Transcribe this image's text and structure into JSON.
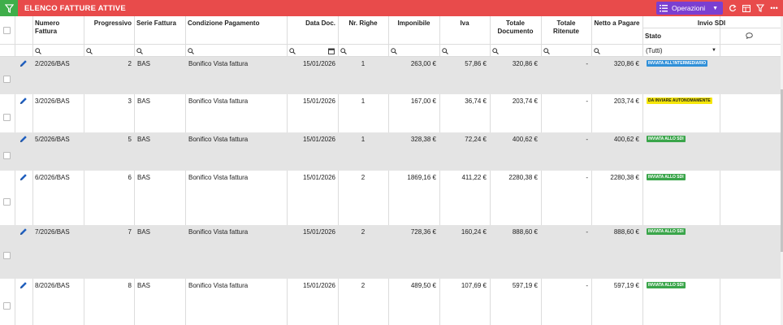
{
  "header": {
    "title": "ELENCO FATTURE ATTIVE",
    "operations_label": "Operazioni",
    "filter_icon": "filter-funnel-icon"
  },
  "colors": {
    "topbar": "#e84b4b",
    "filter_button": "#3fae4a",
    "operations_button": "#7a3fd1",
    "badge_blue": "#2f8fd8",
    "badge_yellow": "#f5e60a",
    "badge_green": "#3aa54a"
  },
  "columns": {
    "numero": "Numero Fattura",
    "progressivo": "Progressivo",
    "serie": "Serie Fattura",
    "condizione": "Condizione Pagamento",
    "data": "Data Doc.",
    "righe": "Nr. Righe",
    "imponibile": "Imponibile",
    "iva": "Iva",
    "totale_1": "Totale",
    "totale_2": "Documento",
    "ritenute": "Totale Ritenute",
    "netto": "Netto a Pagare",
    "sdi": "Invio SDI",
    "stato": "Stato"
  },
  "filters": {
    "stato_selected": "(Tutti)"
  },
  "rows": [
    {
      "numero": "2/2026/BAS",
      "progressivo": "2",
      "serie": "BAS",
      "condizione": "Bonifico Vista fattura",
      "data": "15/01/2026",
      "righe": "1",
      "imponibile": "263,00 €",
      "iva": "57,86 €",
      "totale": "320,86 €",
      "ritenute": "-",
      "netto": "320,86 €",
      "stato": "INVIATA ALL'INTERMEDIARIO"
    },
    {
      "numero": "3/2026/BAS",
      "progressivo": "3",
      "serie": "BAS",
      "condizione": "Bonifico Vista fattura",
      "data": "15/01/2026",
      "righe": "1",
      "imponibile": "167,00 €",
      "iva": "36,74 €",
      "totale": "203,74 €",
      "ritenute": "-",
      "netto": "203,74 €",
      "stato": "DA INVIARE AUTONOMAMENTE"
    },
    {
      "numero": "5/2026/BAS",
      "progressivo": "5",
      "serie": "BAS",
      "condizione": "Bonifico Vista fattura",
      "data": "15/01/2026",
      "righe": "1",
      "imponibile": "328,38 €",
      "iva": "72,24 €",
      "totale": "400,62 €",
      "ritenute": "-",
      "netto": "400,62 €",
      "stato": "INVIATA ALLO SDI"
    },
    {
      "numero": "6/2026/BAS",
      "progressivo": "6",
      "serie": "BAS",
      "condizione": "Bonifico Vista fattura",
      "data": "15/01/2026",
      "righe": "2",
      "imponibile": "1869,16 €",
      "iva": "411,22 €",
      "totale": "2280,38 €",
      "ritenute": "-",
      "netto": "2280,38 €",
      "stato": "INVIATA ALLO SDI"
    },
    {
      "numero": "7/2026/BAS",
      "progressivo": "7",
      "serie": "BAS",
      "condizione": "Bonifico Vista fattura",
      "data": "15/01/2026",
      "righe": "2",
      "imponibile": "728,36 €",
      "iva": "160,24 €",
      "totale": "888,60 €",
      "ritenute": "-",
      "netto": "888,60 €",
      "stato": "INVIATA ALLO SDI"
    },
    {
      "numero": "8/2026/BAS",
      "progressivo": "8",
      "serie": "BAS",
      "condizione": "Bonifico Vista fattura",
      "data": "15/01/2026",
      "righe": "2",
      "imponibile": "489,50 €",
      "iva": "107,69 €",
      "totale": "597,19 €",
      "ritenute": "-",
      "netto": "597,19 €",
      "stato": "INVIATA ALLO SDI"
    }
  ]
}
